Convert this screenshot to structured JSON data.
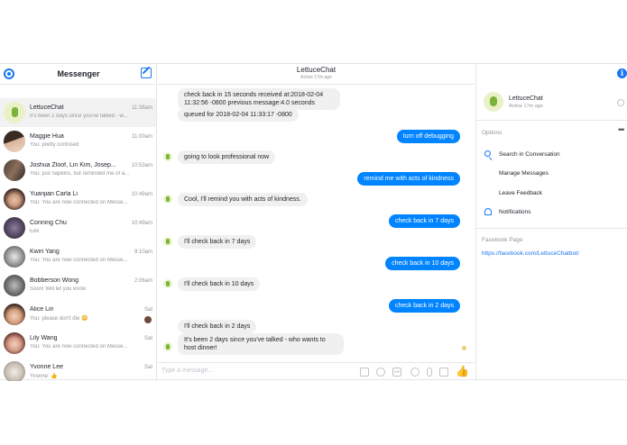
{
  "sidebar": {
    "title": "Messenger",
    "conversations": [
      {
        "name": "LettuceChat",
        "preview": "It's been 2 days since you've talked - w...",
        "time": "11:38am"
      },
      {
        "name": "Maggie Hua",
        "preview": "You: pretty confused",
        "time": "11:00am"
      },
      {
        "name": "Joshua Zloof, Lin Kim, Josep...",
        "preview": "You: just napkins, but reminded me of a...",
        "time": "10:53am"
      },
      {
        "name": "Yuanjian Carla Li",
        "preview": "You: You are now connected on Messe...",
        "time": "10:49am"
      },
      {
        "name": "Conning Chu",
        "preview": "Eek",
        "time": "10:49am"
      },
      {
        "name": "Kwiri Yang",
        "preview": "You: You are now connected on Messe...",
        "time": "9:10am"
      },
      {
        "name": "Bobberson Wong",
        "preview": "Soon! Will let you know",
        "time": "2:06am"
      },
      {
        "name": "Alice Lin",
        "preview": "You: please don't die 😳",
        "time": "Sat"
      },
      {
        "name": "Lily Wang",
        "preview": "You: You are now connected on Messe...",
        "time": "Sat"
      },
      {
        "name": "Yvonne Lee",
        "preview": "Yvonne: 👍",
        "time": "Sat"
      }
    ]
  },
  "chat": {
    "title": "LettuceChat",
    "subtitle": "Active 17m ago",
    "messages": [
      {
        "dir": "in",
        "text": "check back in 15 seconds received at:2018-02-04 11:32:56 -0800 previous message:4.0 seconds"
      },
      {
        "dir": "in",
        "text": "queued for 2018-02-04 11:33:17 -0800"
      },
      {
        "dir": "out",
        "text": "turn off debugging"
      },
      {
        "dir": "in",
        "text": "going to look professional now"
      },
      {
        "dir": "out",
        "text": "remind me with acts of kindness"
      },
      {
        "dir": "in",
        "text": "Cool, I'll remind you with acts of kindness."
      },
      {
        "dir": "out",
        "text": "check back in 7 days"
      },
      {
        "dir": "in",
        "text": "I'll check back in 7 days"
      },
      {
        "dir": "out",
        "text": "check back in 10 days"
      },
      {
        "dir": "in",
        "text": "I'll check back in 10 days"
      },
      {
        "dir": "out",
        "text": "check back in 2 days"
      },
      {
        "dir": "in",
        "text": "I'll check back in 2 days"
      },
      {
        "dir": "in",
        "text": "It's been 2 days since you've talked - who wants to host dinner!"
      }
    ],
    "composer_placeholder": "Type a message..."
  },
  "details": {
    "name": "LettuceChat",
    "subtitle": "Active 17m ago",
    "options_label": "Options",
    "options": [
      "Search in Conversation",
      "Manage Messages",
      "Leave Feedback",
      "Notifications"
    ],
    "facebook_page_label": "Facebook Page",
    "facebook_page_url": "https://facebook.com/LettuceChatbot/"
  },
  "colors": {
    "accent": "#1877f2",
    "outgoing_bubble": "#0084ff",
    "incoming_bubble": "#f1f0f0"
  },
  "icons": [
    "settings-gear-icon",
    "compose-icon",
    "info-icon",
    "search-icon",
    "bell-icon",
    "like-icon"
  ]
}
